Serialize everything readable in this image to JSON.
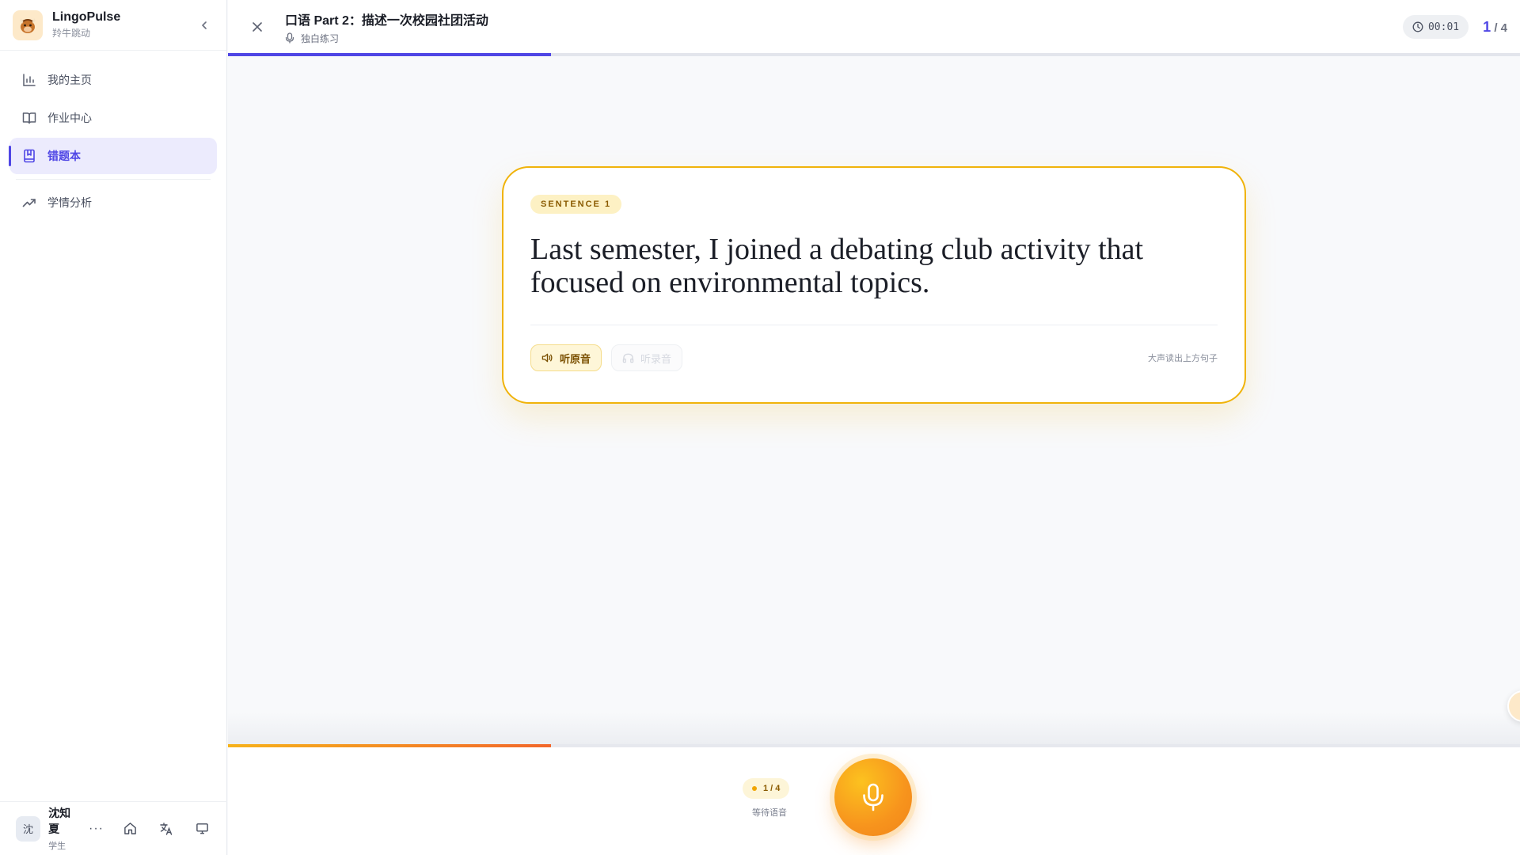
{
  "app": {
    "name": "LingoPulse",
    "subtitle": "羚牛跳动"
  },
  "sidebar": {
    "items": [
      {
        "label": "我的主页",
        "icon": "bar-chart-icon"
      },
      {
        "label": "作业中心",
        "icon": "book-open-icon"
      },
      {
        "label": "错题本",
        "icon": "bookmark-book-icon",
        "active": true
      },
      {
        "label": "学情分析",
        "icon": "trending-up-icon"
      }
    ]
  },
  "user": {
    "avatar_text": "沈",
    "name": "沈知夏",
    "role": "学生",
    "more": "···"
  },
  "header": {
    "title": "口语 Part 2：描述一次校园社团活动",
    "mode": "独白练习",
    "timer": "00:01",
    "current": "1",
    "total": "/ 4",
    "progress": 0.25
  },
  "card": {
    "badge": "SENTENCE 1",
    "sentence": "Last semester, I joined a debating club activity that focused on environmental topics.",
    "listen_label": "听原音",
    "recording_label": "听录音",
    "hint": "大声读出上方句子"
  },
  "bottom": {
    "progress": 0.25,
    "count": "1 / 4",
    "status": "等待语音"
  },
  "colors": {
    "accent": "#4f46e5",
    "card_border": "#f0b30a",
    "mic": "#f7941d"
  }
}
